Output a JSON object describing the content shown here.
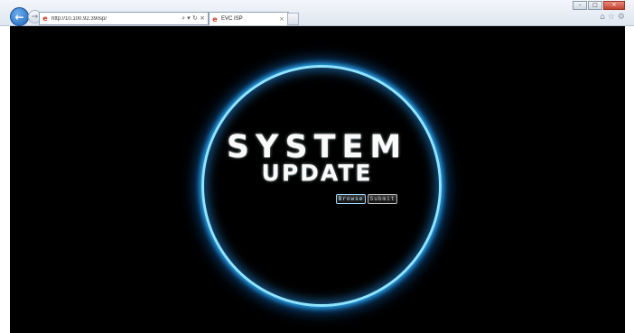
{
  "browser": {
    "url": "http://10.100.92.39/isp/",
    "tab_title": "EVC ISP",
    "address_controls": "⌕ ▾ ↻ ×",
    "tab_close": "×",
    "back_glyph": "←",
    "forward_glyph": "→",
    "ie_glyph": "e",
    "tools": [
      "⌂",
      "☆",
      "⚙"
    ],
    "window_controls": [
      "–",
      "□",
      "✕"
    ]
  },
  "page": {
    "title_line1": "SYSTEM",
    "title_line2": "UPDATE",
    "browse_label": "Browse",
    "submit_label": "Submit",
    "background_color": "#000000",
    "ring_color": "#4fc3ff"
  }
}
